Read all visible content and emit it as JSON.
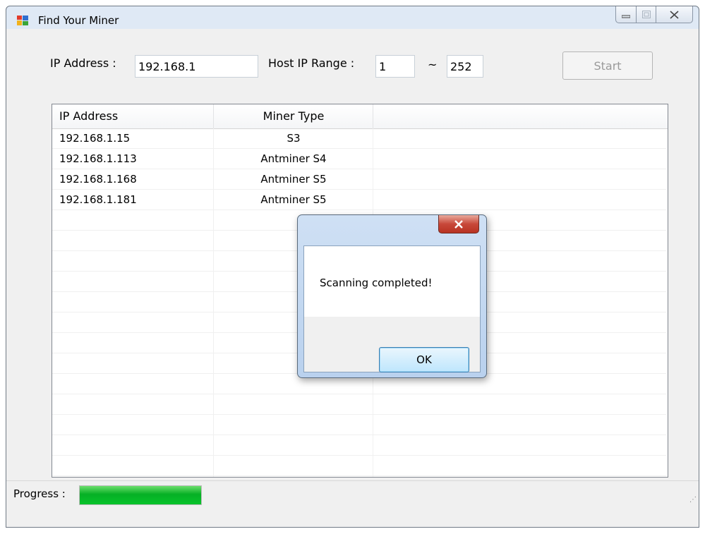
{
  "window": {
    "title": "Find Your Miner"
  },
  "form": {
    "ip_label": "IP Address :",
    "ip_value": "192.168.1",
    "range_label": "Host IP Range :",
    "range_start": "1",
    "range_sep": "~",
    "range_end": "252",
    "start_label": "Start"
  },
  "table": {
    "columns": [
      "IP Address",
      "Miner Type"
    ],
    "rows": [
      {
        "ip": "192.168.1.15",
        "type": "S3"
      },
      {
        "ip": "192.168.1.113",
        "type": "Antminer S4"
      },
      {
        "ip": "192.168.1.168",
        "type": "Antminer S5"
      },
      {
        "ip": "192.168.1.181",
        "type": "Antminer S5"
      }
    ]
  },
  "status": {
    "progress_label": "Progress :",
    "progress_fraction": 1.0
  },
  "dialog": {
    "message": "Scanning completed!",
    "ok_label": "OK"
  },
  "icons": {
    "app": "window-app-icon",
    "minimize": "minimize-icon",
    "maximize": "maximize-icon",
    "close": "close-icon",
    "grip": "resize-grip-icon"
  },
  "colors": {
    "progress": "#06b025",
    "dialog_close": "#c8483a"
  }
}
